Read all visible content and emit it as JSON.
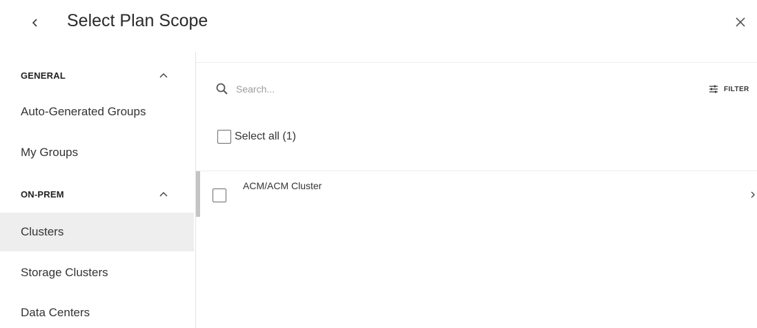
{
  "header": {
    "title": "Select Plan Scope",
    "back_icon": "chevron-left-icon",
    "close_icon": "close-icon"
  },
  "sidebar": {
    "sections": [
      {
        "label": "GENERAL",
        "expanded": true,
        "items": [
          {
            "label": "Auto-Generated Groups",
            "active": false
          },
          {
            "label": "My Groups",
            "active": false
          }
        ]
      },
      {
        "label": "ON-PREM",
        "expanded": true,
        "items": [
          {
            "label": "Clusters",
            "active": true
          },
          {
            "label": "Storage Clusters",
            "active": false
          },
          {
            "label": "Data Centers",
            "active": false
          }
        ]
      }
    ]
  },
  "search": {
    "placeholder": "Search...",
    "value": ""
  },
  "filter": {
    "label": "FILTER",
    "icon": "sliders-icon"
  },
  "select_all": {
    "label": "Select all (1)",
    "checked": false
  },
  "list": {
    "items": [
      {
        "label": "ACM/ACM Cluster",
        "checked": false
      }
    ]
  },
  "colors": {
    "active_item_bg": "#eeeeee",
    "row_accent": "#c4c4c4",
    "divider": "#ececec",
    "text": "#333333",
    "placeholder": "#9b9b9b"
  }
}
